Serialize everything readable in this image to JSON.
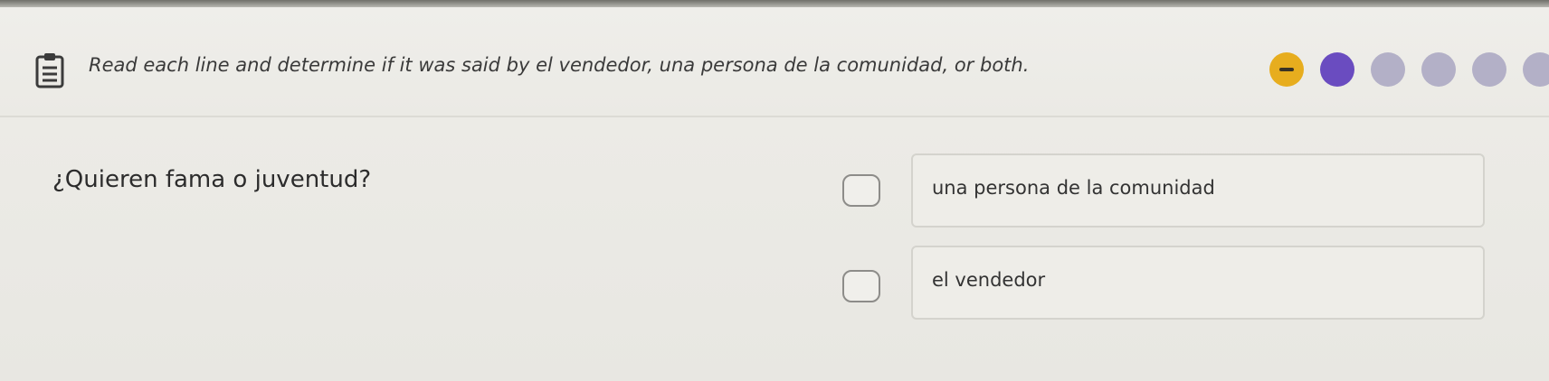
{
  "header": {
    "instruction": "Read each line and determine if it was said by el vendedor, una persona de la comunidad, or both.",
    "icon": "clipboard-icon",
    "progress": {
      "total": 6,
      "current_index": 0,
      "states": [
        "current",
        "done",
        "pending",
        "pending",
        "pending",
        "pending"
      ],
      "colors": {
        "current": "#e7ad1e",
        "done": "#6a4cc0",
        "pending": "#b3b0c7"
      }
    }
  },
  "question": {
    "text": "¿Quieren fama o juventud?",
    "options": [
      {
        "label": "una persona de la comunidad",
        "selected": false
      },
      {
        "label": "el vendedor",
        "selected": false
      }
    ]
  }
}
